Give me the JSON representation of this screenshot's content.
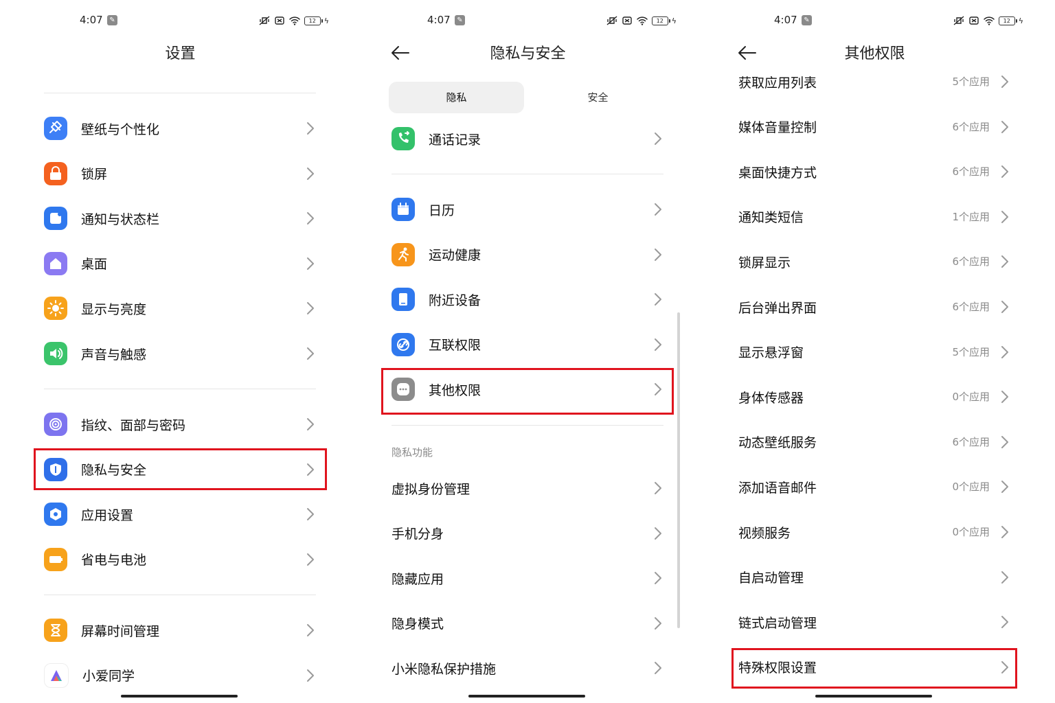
{
  "status": {
    "time": "4:07",
    "battery": "12"
  },
  "screen1": {
    "title": "设置",
    "groups": [
      [
        {
          "label": "壁纸与个性化",
          "icon": "brush-icon",
          "color": "#3d7ff6"
        },
        {
          "label": "锁屏",
          "icon": "lock-icon",
          "color": "#f4611f"
        },
        {
          "label": "通知与状态栏",
          "icon": "notification-icon",
          "color": "#2f78ee"
        },
        {
          "label": "桌面",
          "icon": "home-icon",
          "color": "#8b7af2"
        },
        {
          "label": "显示与亮度",
          "icon": "sun-icon",
          "color": "#f7a21b"
        },
        {
          "label": "声音与触感",
          "icon": "speaker-icon",
          "color": "#3bc46b"
        }
      ],
      [
        {
          "label": "指纹、面部与密码",
          "icon": "fingerprint-icon",
          "color": "#7d74ef"
        },
        {
          "label": "隐私与安全",
          "icon": "shield-icon",
          "color": "#2f6fe9"
        },
        {
          "label": "应用设置",
          "icon": "app-settings-icon",
          "color": "#2f78ee"
        },
        {
          "label": "省电与电池",
          "icon": "battery-saver-icon",
          "color": "#f7a21b"
        }
      ],
      [
        {
          "label": "屏幕时间管理",
          "icon": "hourglass-icon",
          "color": "#f7a21b"
        },
        {
          "label": "小爱同学",
          "icon": "xiaoai-icon",
          "color": "#ffffff"
        }
      ]
    ]
  },
  "screen2": {
    "title": "隐私与安全",
    "tabs": [
      "隐私",
      "安全"
    ],
    "top_items": [
      {
        "label": "通话记录",
        "icon": "phone-icon",
        "color": "#33c16a"
      }
    ],
    "perm_items": [
      {
        "label": "日历",
        "icon": "calendar-icon",
        "color": "#2f78ee"
      },
      {
        "label": "运动健康",
        "icon": "running-icon",
        "color": "#f7951b"
      },
      {
        "label": "附近设备",
        "icon": "device-icon",
        "color": "#2f78ee"
      },
      {
        "label": "互联权限",
        "icon": "link-icon",
        "color": "#2f78ee"
      },
      {
        "label": "其他权限",
        "icon": "more-icon",
        "color": "#8c8c8c"
      }
    ],
    "section_title": "隐私功能",
    "feature_items": [
      "虚拟身份管理",
      "手机分身",
      "隐藏应用",
      "隐身模式",
      "小米隐私保护措施"
    ]
  },
  "screen3": {
    "title": "其他权限",
    "items": [
      {
        "label": "获取应用列表",
        "meta": "5个应用"
      },
      {
        "label": "媒体音量控制",
        "meta": "6个应用"
      },
      {
        "label": "桌面快捷方式",
        "meta": "6个应用"
      },
      {
        "label": "通知类短信",
        "meta": "1个应用"
      },
      {
        "label": "锁屏显示",
        "meta": "6个应用"
      },
      {
        "label": "后台弹出界面",
        "meta": "6个应用"
      },
      {
        "label": "显示悬浮窗",
        "meta": "5个应用"
      },
      {
        "label": "身体传感器",
        "meta": "0个应用"
      },
      {
        "label": "动态壁纸服务",
        "meta": "6个应用"
      },
      {
        "label": "添加语音邮件",
        "meta": "0个应用"
      },
      {
        "label": "视频服务",
        "meta": "0个应用"
      },
      {
        "label": "自启动管理",
        "meta": ""
      },
      {
        "label": "链式启动管理",
        "meta": ""
      },
      {
        "label": "特殊权限设置",
        "meta": ""
      }
    ]
  },
  "highlight_color": "#e0141e"
}
